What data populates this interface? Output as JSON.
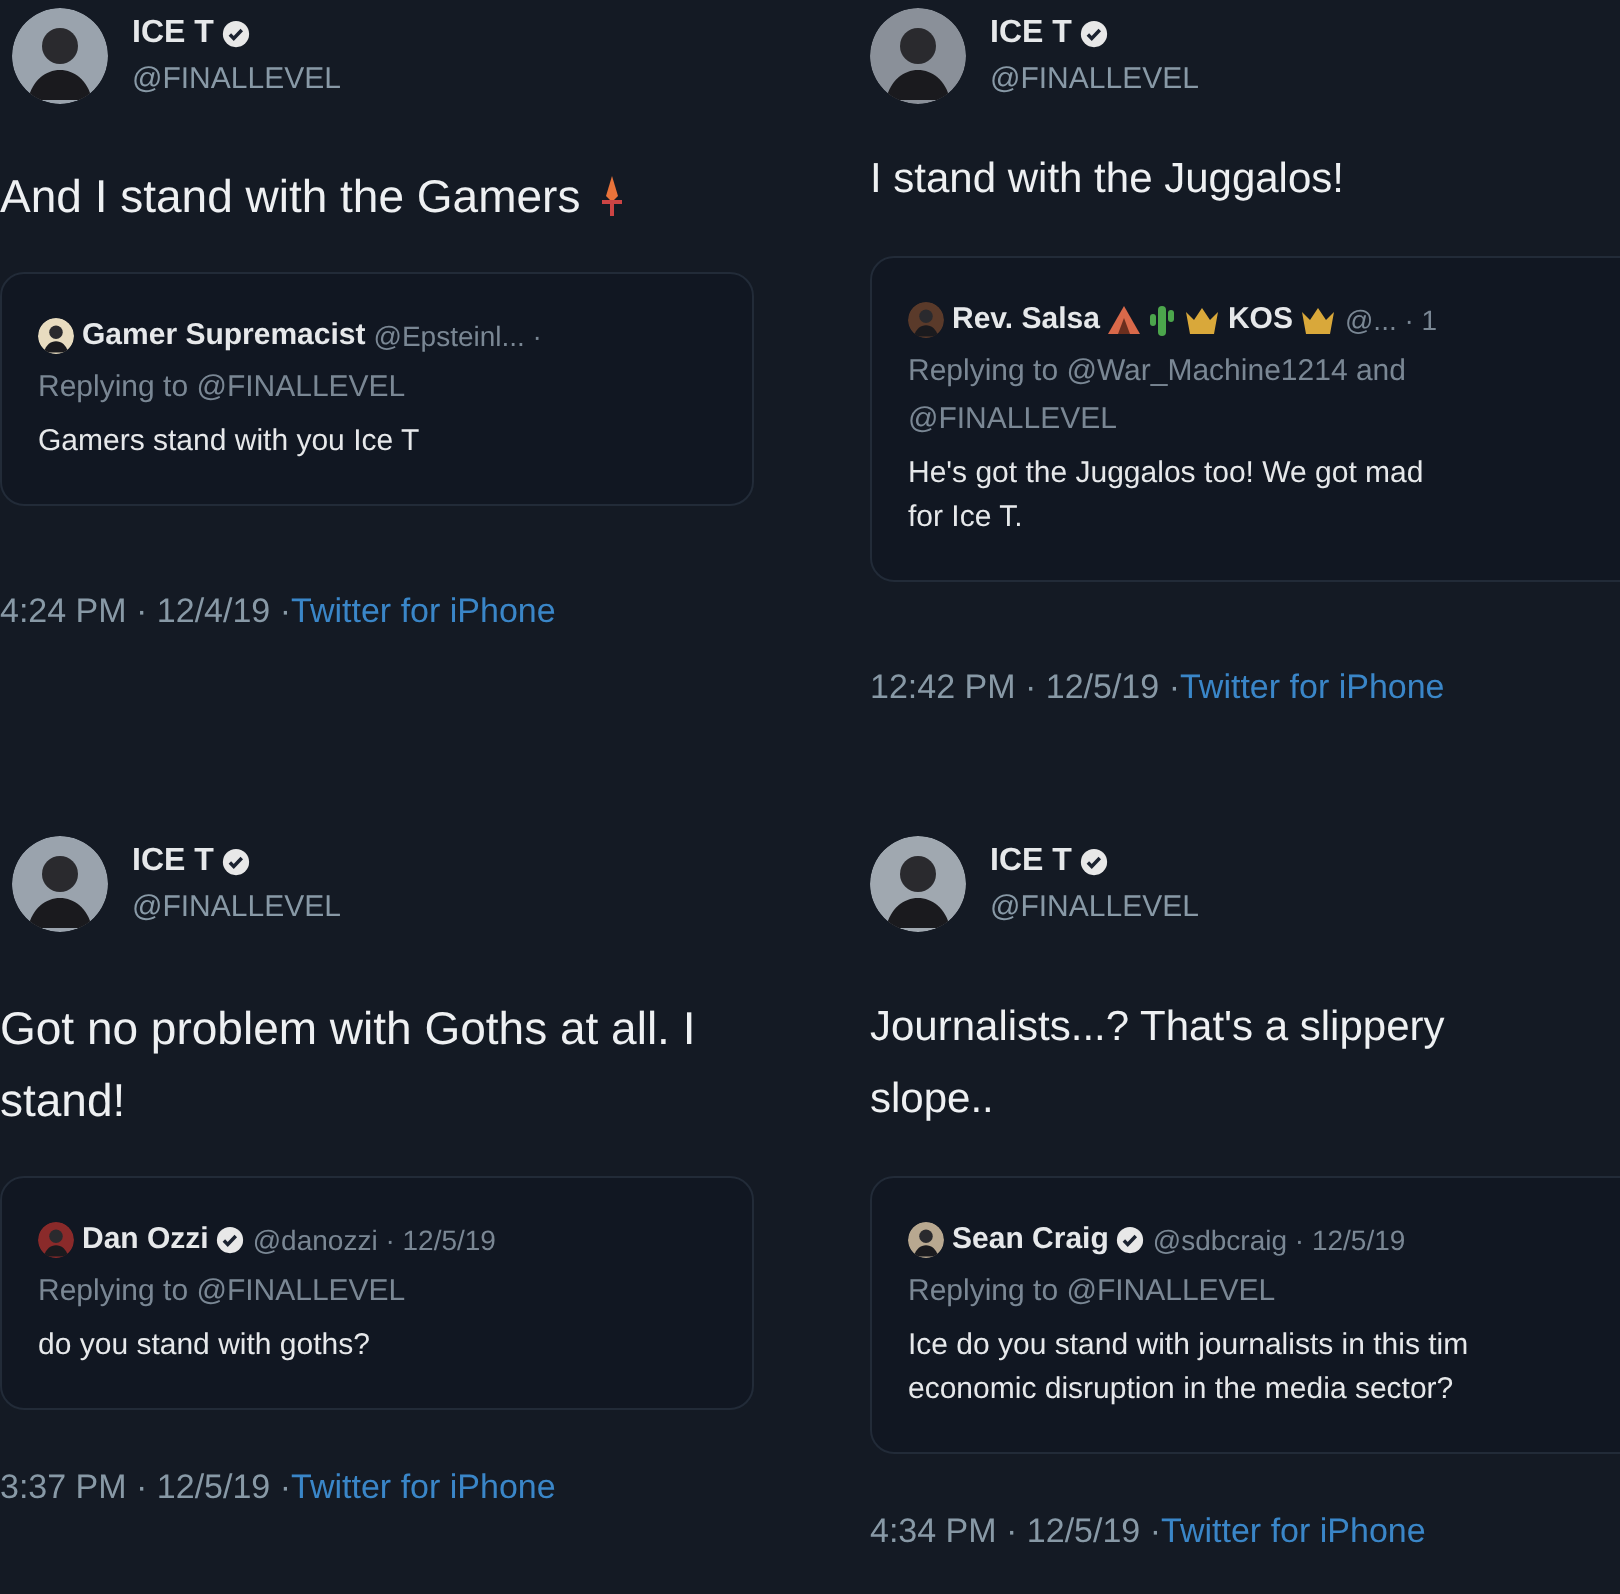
{
  "panels": [
    {
      "author": {
        "name": "ICE T",
        "handle": "@FINALLEVEL",
        "verified": true
      },
      "text_lines": [
        "And I stand with the Gamers"
      ],
      "quote": {
        "name": "Gamer Supremacist",
        "verified": false,
        "meta": "@Epsteinl... ·",
        "replying": "Replying to @FINALLEVEL",
        "text_lines": [
          "Gamers stand with you Ice T"
        ]
      },
      "timestamp": "4:24 PM · 12/4/19 ·",
      "source": "Twitter for iPhone"
    },
    {
      "author": {
        "name": "ICE T",
        "handle": "@FINALLEVEL",
        "verified": true
      },
      "text_lines": [
        "I stand with the Juggalos!"
      ],
      "quote": {
        "name": "Rev. Salsa",
        "name_2": "KOS",
        "verified": false,
        "meta": "@... · 1",
        "replying": "Replying to @War_Machine1214 and",
        "replying_2": "@FINALLEVEL",
        "text_lines": [
          "He's got the Juggalos too! We got mad",
          "for Ice T."
        ]
      },
      "timestamp": "12:42 PM · 12/5/19 ·",
      "source": "Twitter for iPhone"
    },
    {
      "author": {
        "name": "ICE T",
        "handle": "@FINALLEVEL",
        "verified": true
      },
      "text_lines": [
        "Got no problem with Goths at all. I",
        "stand!"
      ],
      "quote": {
        "name": "Dan Ozzi",
        "verified": true,
        "meta": "@danozzi · 12/5/19",
        "replying": "Replying to @FINALLEVEL",
        "text_lines": [
          "do you stand with goths?"
        ]
      },
      "timestamp": "3:37 PM · 12/5/19 ·",
      "source": "Twitter for iPhone"
    },
    {
      "author": {
        "name": "ICE T",
        "handle": "@FINALLEVEL",
        "verified": true
      },
      "text_lines": [
        "Journalists...? That's a slippery",
        "slope.."
      ],
      "quote": {
        "name": "Sean Craig",
        "verified": true,
        "meta": "@sdbcraig · 12/5/19",
        "replying": "Replying to @FINALLEVEL",
        "text_lines": [
          "Ice do you stand with journalists in this tim",
          "economic disruption in the media sector?"
        ]
      },
      "timestamp": "4:34 PM · 12/5/19 ·",
      "source": "Twitter for iPhone"
    }
  ]
}
